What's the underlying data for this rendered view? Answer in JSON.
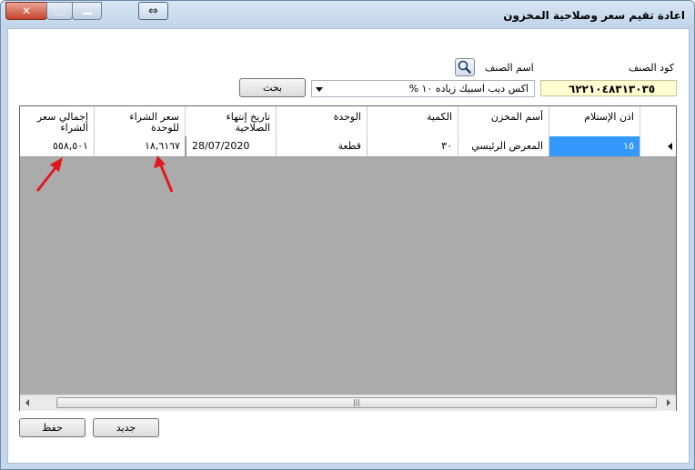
{
  "window": {
    "title": "اعادة تقيم سعر وصلاحية المخزون"
  },
  "form": {
    "item_code_label": "كود الصنف",
    "item_code_value": "٦٢٢١٠٤٨٣١٣٠٣٥",
    "item_name_label": "اسم الصنف",
    "item_name_value": "اكس ديب اسبيك زياده ١٠ %",
    "search_label": "بحث"
  },
  "grid": {
    "columns": [
      "اذن الإستلام",
      "أسم المخزن",
      "الكمية",
      "الوحدة",
      "تاريخ إنتهاء الصلاحية",
      "سعر الشراء للوحدة",
      "إجمالي سعر الشراء"
    ],
    "rows": [
      {
        "receipt": "١٥",
        "store": "المعرض الرئيسي",
        "qty": "٣٠",
        "unit": "قطعة",
        "expiry": "28/07/2020",
        "unit_price": "١٨,٦١٦٧",
        "total": "٥٥٨,٥٠١"
      }
    ]
  },
  "buttons": {
    "new_label": "جديد",
    "save_label": "حفظ"
  },
  "icons": {
    "search": "search-icon",
    "swap": "swap-arrows-icon",
    "row_pointer": "row-pointer-icon"
  },
  "colors": {
    "code_bg": "#fefed0",
    "selected_cell": "#3399ff",
    "grid_empty": "#ababab",
    "annotation_arrow": "#e0191e"
  }
}
